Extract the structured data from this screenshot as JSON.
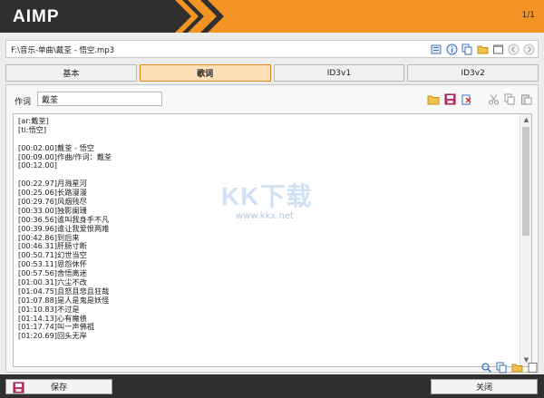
{
  "app": {
    "logo": "AIMP",
    "counter": "1/1"
  },
  "path": {
    "value": "F:\\音乐-单曲\\戴荃 - 悟空.mp3"
  },
  "tabs": [
    {
      "label": "基本"
    },
    {
      "label": "歌词"
    },
    {
      "label": "ID3v1"
    },
    {
      "label": "ID3v2"
    }
  ],
  "author": {
    "label": "作词",
    "value": "戴荃"
  },
  "lyrics": {
    "lines": [
      "[ar:戴荃]",
      "[ti:悟空]",
      "",
      "[00:02.00]戴荃 - 悟空",
      "[00:09.00]作曲/作词：戴荃",
      "[00:12.00]",
      "",
      "[00:22.97]月溅星河",
      "[00:25.06]长路漫漫",
      "[00:29.76]风烟残尽",
      "[00:33.00]独影阑珊",
      "[00:36.56]谁叫我身手不凡",
      "[00:39.96]谁让我爱恨两难",
      "[00:42.86]到后来",
      "[00:46.31]肝肠寸断",
      "[00:50.71]幻世当空",
      "[00:53.11]恩怨休怀",
      "[00:57.56]舍悟离迷",
      "[01:00.31]六尘不改",
      "[01:04.75]且怒且悲且狂哉",
      "[01:07.88]是人是鬼是妖怪",
      "[01:10.83]不过是",
      "[01:14.13]心有魔债",
      "[01:17.74]叫一声佛祖",
      "[01:20.69]回头无岸"
    ]
  },
  "watermark": {
    "brand": "KK下载",
    "url": "www.kkx.net"
  },
  "footer": {
    "save_label": "保存",
    "close_label": "关闭"
  },
  "colors": {
    "accent": "#f39323",
    "dark": "#2f2f2f",
    "active_tab": "#fde0b8"
  }
}
